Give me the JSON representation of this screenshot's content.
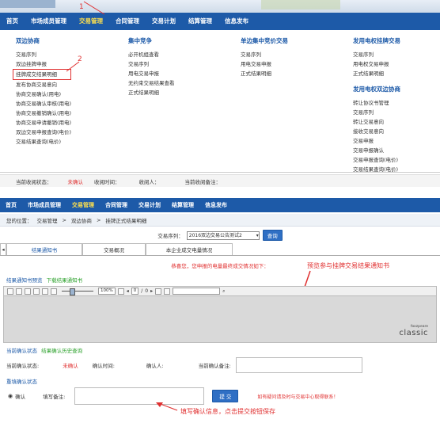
{
  "nav": {
    "items": [
      "首页",
      "市场成员管理",
      "交易管理",
      "合同管理",
      "交易计划",
      "结算管理",
      "信息发布"
    ],
    "active_index": 2
  },
  "menu": {
    "columns": [
      {
        "title": "双边协商",
        "items": [
          "交易序列",
          "双边挂牌申报",
          "挂牌成交结果明细",
          "发布协商交易意向",
          "协商交易确认(用电)",
          "协商交易确认审核(用电)",
          "协商交易撤销确认(用电)",
          "协商交易申请撤销(用电)",
          "双边交易申报查询(电价)",
          "交易结果查询(电价)"
        ]
      },
      {
        "title": "集中竞争",
        "items": [
          "必开机组查看",
          "交易序列",
          "用电交易申报",
          "无约束交易结果查看",
          "正式结果明细"
        ]
      },
      {
        "title": "单边集中竞价交易",
        "items": [
          "交易序列",
          "用电交易申报",
          "正式结果明细"
        ]
      },
      {
        "title": "发用电权挂牌交易",
        "items": [
          "交易序列",
          "用电权交易申报",
          "正式结果明细"
        ]
      },
      {
        "title": "发用电权双边协商",
        "items": [
          "转让协议书管理",
          "交易序列",
          "转让交易意向",
          "接收交易意向",
          "交易申报",
          "交易申报确认",
          "交易申报查询(电价)",
          "交易结果查询(电价)"
        ]
      }
    ],
    "highlight_annotation": "2",
    "nav_annotation": "1"
  },
  "status_row1": {
    "state_label": "当前收阅状态：",
    "state_value": "未确认",
    "time_label": "收阅时间：",
    "person_label": "收阅人：",
    "note_label": "当前收阅备注："
  },
  "crumb": {
    "label": "您的位置：",
    "parts": [
      "交易管理",
      ">",
      "双边协商",
      ">",
      "挂牌正式结果明细"
    ]
  },
  "seq": {
    "label": "交易序列：",
    "selected": "2016双边交易公告测试2",
    "query_button": "查询"
  },
  "tabs": [
    "结果通知书",
    "交易概况",
    "本企业成交电量情况"
  ],
  "notice": "恭喜您，您申报的电量最终成交情况如下：",
  "annot_preview": "预览参与挂牌交易结果通知书",
  "viewer": {
    "label_prefix": "结果通知书预览",
    "download_link": "下载结果通知书",
    "zoom": "100%",
    "page_current": "0",
    "page_sep": "/",
    "page_total": "0",
    "logo_small": "foxzpeare",
    "logo_big": "classic"
  },
  "confirm_state": {
    "title": "当前确认状态",
    "history_link": "结果确认历史查询",
    "state_label": "当前确认状态:",
    "state_value": "未确认",
    "time_label": "确认时间:",
    "person_label": "确认人:",
    "note_label": "当前确认备注:"
  },
  "reconfirm": {
    "title": "重填确认状态",
    "radio_label": "确认",
    "note_label": "填写备注:",
    "submit": "提 交",
    "contact": "如有疑问请及时与交易中心取得联系！",
    "annot_fill": "填写确认信息，点击提交按钮保存"
  },
  "colors": {
    "nav_bg": "#1d5aa8",
    "nav_active": "#ffe14d",
    "annotation_red": "#e03030",
    "link_green": "#2aa02a"
  }
}
